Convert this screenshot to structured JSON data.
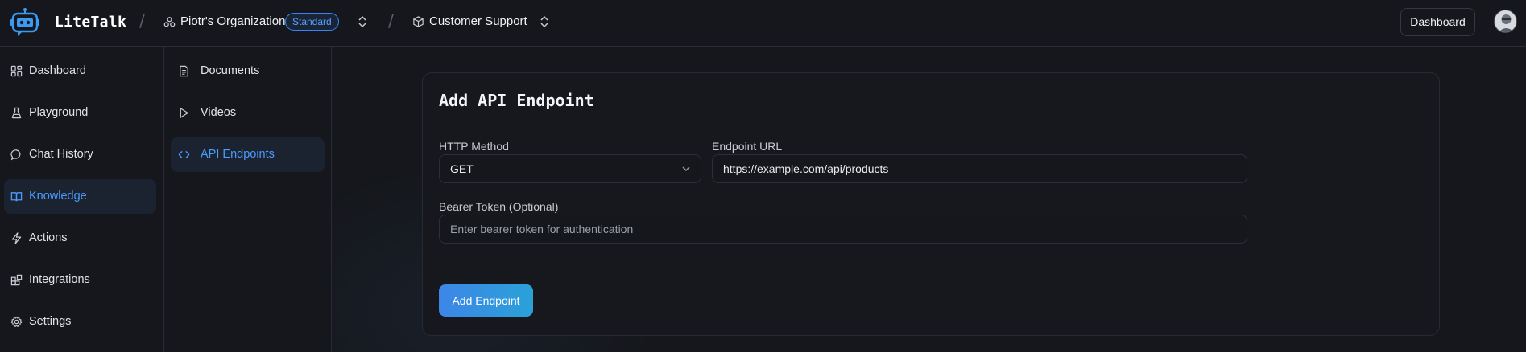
{
  "app": {
    "name": "LiteTalk"
  },
  "topbar": {
    "org_name": "Piotr's Organization",
    "plan_badge": "Standard",
    "project_name": "Customer Support",
    "dashboard_button": "Dashboard"
  },
  "sidebar": {
    "items": [
      {
        "label": "Dashboard",
        "icon": "dashboard-icon"
      },
      {
        "label": "Playground",
        "icon": "flask-icon"
      },
      {
        "label": "Chat History",
        "icon": "chat-bubble-icon"
      },
      {
        "label": "Knowledge",
        "icon": "book-icon",
        "active": true
      },
      {
        "label": "Actions",
        "icon": "lightning-icon"
      },
      {
        "label": "Integrations",
        "icon": "blocks-icon"
      },
      {
        "label": "Settings",
        "icon": "gear-icon"
      }
    ]
  },
  "subnav": {
    "items": [
      {
        "label": "Documents",
        "icon": "document-icon"
      },
      {
        "label": "Videos",
        "icon": "play-icon"
      },
      {
        "label": "API Endpoints",
        "icon": "code-icon",
        "active": true
      }
    ]
  },
  "form": {
    "title": "Add API Endpoint",
    "http_method_label": "HTTP Method",
    "http_method_value": "GET",
    "endpoint_url_label": "Endpoint URL",
    "endpoint_url_value": "https://example.com/api/products",
    "bearer_label": "Bearer Token (Optional)",
    "bearer_placeholder": "Enter bearer token for authentication",
    "submit_label": "Add Endpoint"
  },
  "colors": {
    "accent": "#4b9bff",
    "background": "#15171c",
    "button_gradient_start": "#3d86e8",
    "button_gradient_end": "#2aa1d8"
  }
}
